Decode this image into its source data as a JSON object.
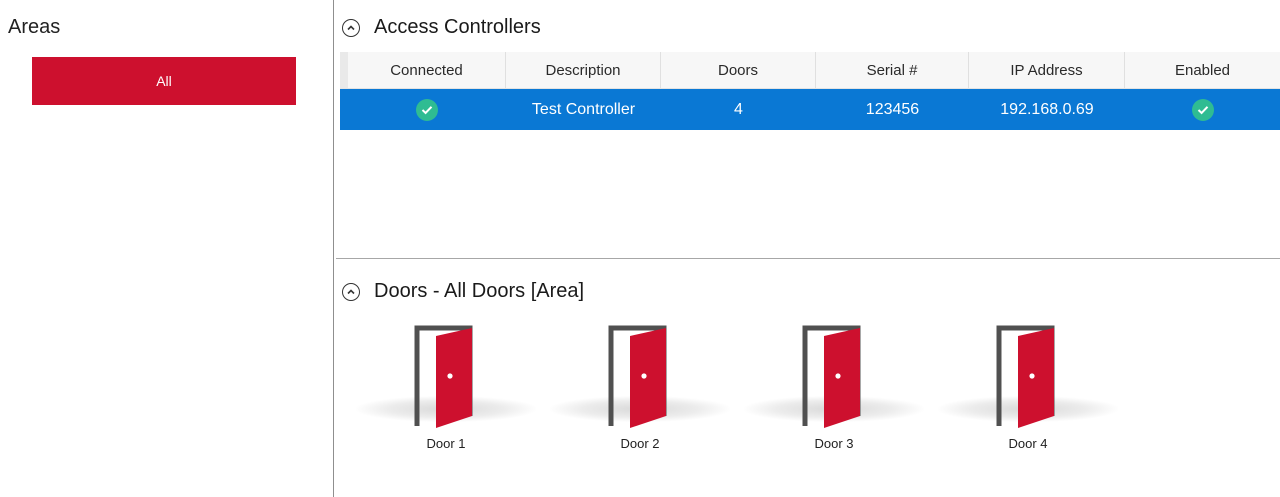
{
  "areas": {
    "title": "Areas",
    "items": [
      {
        "label": "All",
        "selected": true
      }
    ]
  },
  "controllers": {
    "title": "Access Controllers",
    "columns": [
      "Connected",
      "Description",
      "Doors",
      "Serial #",
      "IP Address",
      "Enabled"
    ],
    "rows": [
      {
        "connected": true,
        "description": "Test Controller",
        "doors": "4",
        "serial": "123456",
        "ip": "192.168.0.69",
        "enabled": true
      }
    ]
  },
  "doors": {
    "title": "Doors - All Doors [Area]",
    "items": [
      {
        "label": "Door 1"
      },
      {
        "label": "Door 2"
      },
      {
        "label": "Door 3"
      },
      {
        "label": "Door 4"
      }
    ]
  },
  "colors": {
    "accent_red": "#cd102e",
    "selection_blue": "#0a78d4",
    "check_green": "#2fbc92",
    "frame_gray": "#505050"
  },
  "icons": [
    "chevron-up-circle-icon",
    "check-circle-icon",
    "door-open-icon"
  ]
}
